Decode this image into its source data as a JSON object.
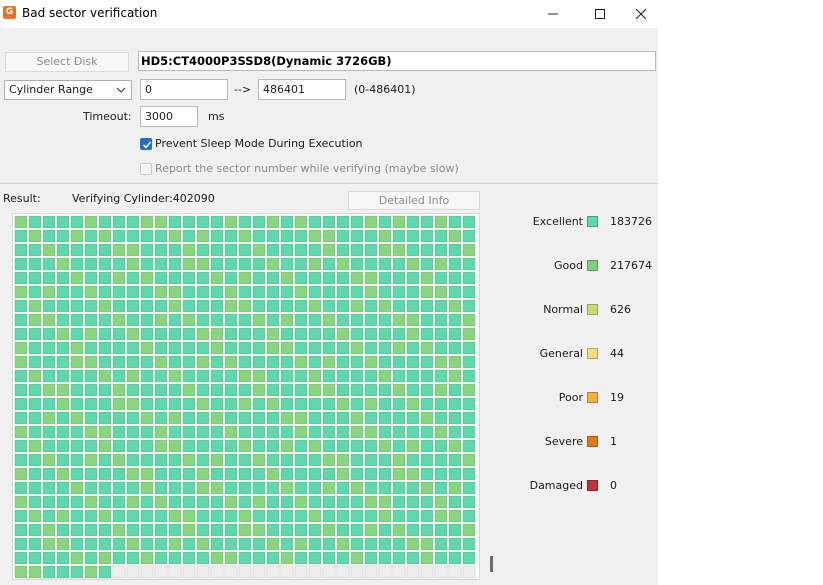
{
  "window": {
    "title": "Bad sector verification",
    "icon": "app-logo-icon"
  },
  "disk": {
    "select_label": "Select Disk",
    "name": "HD5:CT4000P3SSD8(Dynamic 3726GB)"
  },
  "range": {
    "mode": "Cylinder Range",
    "from": "0",
    "arrow": "-->",
    "to": "486401",
    "hint": "(0-486401)"
  },
  "timeout": {
    "label": "Timeout:",
    "value": "3000",
    "unit": "ms"
  },
  "options": {
    "prevent_sleep": {
      "label": "Prevent Sleep Mode During Execution",
      "checked": true
    },
    "report_sector": {
      "label": "Report the sector number while verifying (maybe slow)",
      "checked": false,
      "enabled": false
    }
  },
  "result": {
    "label": "Result:",
    "status": "Verifying Cylinder:402090",
    "detail_button": "Detailed Info"
  },
  "legend": [
    {
      "label": "Excellent",
      "color": "#5fd8ac",
      "count": "183726"
    },
    {
      "label": "Good",
      "color": "#7fd27a",
      "count": "217674"
    },
    {
      "label": "Normal",
      "color": "#c5dc73",
      "count": "626"
    },
    {
      "label": "General",
      "color": "#f3dc7d",
      "count": "44"
    },
    {
      "label": "Poor",
      "color": "#f5ae3c",
      "count": "19"
    },
    {
      "label": "Severe",
      "color": "#e07b1c",
      "count": "1"
    },
    {
      "label": "Damaged",
      "color": "#c4323e",
      "count": "0"
    }
  ],
  "block_grid": {
    "columns": 33,
    "rows": 26,
    "completed_fraction": 0.9699,
    "colors": {
      "excellent": "#5fd8ac",
      "good": "#8ad580",
      "pending": "#eeeeee"
    }
  }
}
